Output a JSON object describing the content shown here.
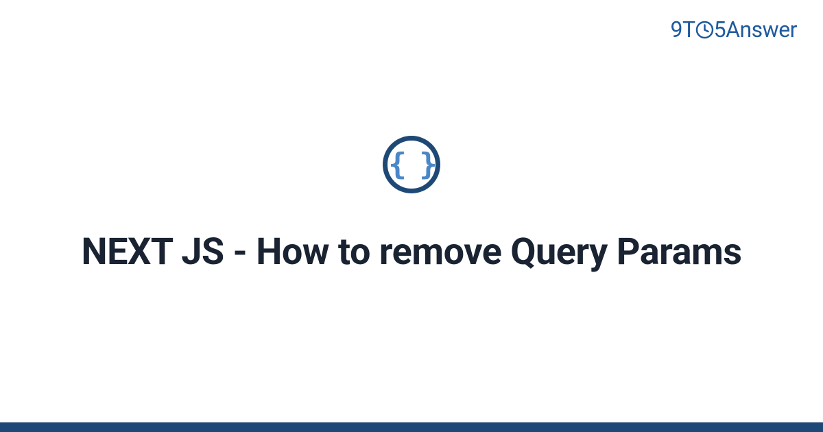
{
  "brand": {
    "prefix": "9T",
    "suffix": "5Answer"
  },
  "icon": {
    "braces": "{ }"
  },
  "content": {
    "title": "NEXT JS - How to remove Query Params"
  },
  "colors": {
    "brand": "#1e5a9e",
    "icon_border": "#1e4976",
    "icon_fill": "#4a87c7",
    "title": "#1a2332",
    "bottom_bar": "#1e4976"
  }
}
